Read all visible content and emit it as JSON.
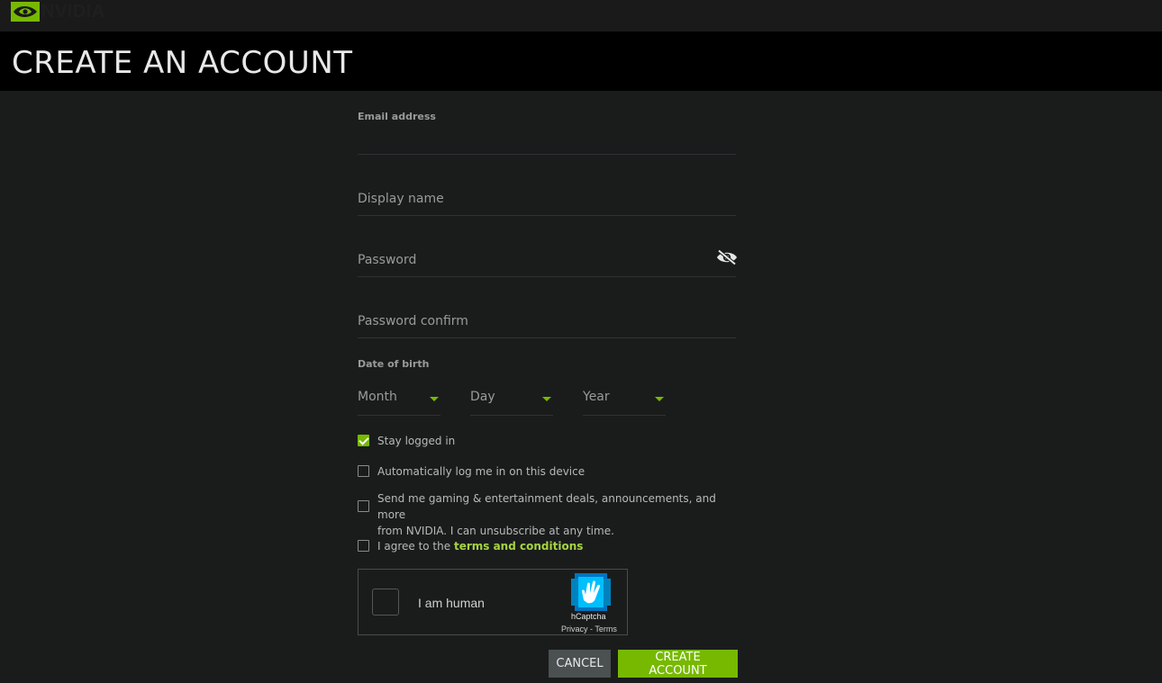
{
  "brand": {
    "name": "NVIDIA"
  },
  "page": {
    "title": "CREATE AN ACCOUNT"
  },
  "form": {
    "email": {
      "label": "Email address",
      "value": ""
    },
    "display_name": {
      "placeholder": "Display name",
      "value": ""
    },
    "password": {
      "placeholder": "Password",
      "value": ""
    },
    "password_confirm": {
      "placeholder": "Password confirm",
      "value": ""
    },
    "dob": {
      "label": "Date of birth",
      "month": "Month",
      "day": "Day",
      "year": "Year"
    },
    "checkboxes": {
      "stay_logged_in": {
        "label": "Stay logged in",
        "checked": true
      },
      "auto_login": {
        "label": "Automatically log me in on this device",
        "checked": false
      },
      "marketing": {
        "label_line1": "Send me gaming & entertainment deals, announcements, and more",
        "label_line2": "from NVIDIA. I can unsubscribe at any time.",
        "checked": false
      },
      "terms": {
        "label_prefix": "I agree to the",
        "link_text": "terms and conditions",
        "checked": false
      }
    },
    "captcha": {
      "text": "I am human",
      "brand": "hCaptcha",
      "links": "Privacy - Terms"
    },
    "buttons": {
      "cancel": "CANCEL",
      "create": "CREATE ACCOUNT"
    }
  },
  "colors": {
    "accent": "#76b900",
    "link": "#a6d441",
    "background": "#1a1c1c",
    "title_bar": "#000000"
  },
  "icons": {
    "logo": "nvidia-eye-logo",
    "password_toggle": "eye-slash-icon",
    "captcha": "hcaptcha-hand-icon"
  }
}
